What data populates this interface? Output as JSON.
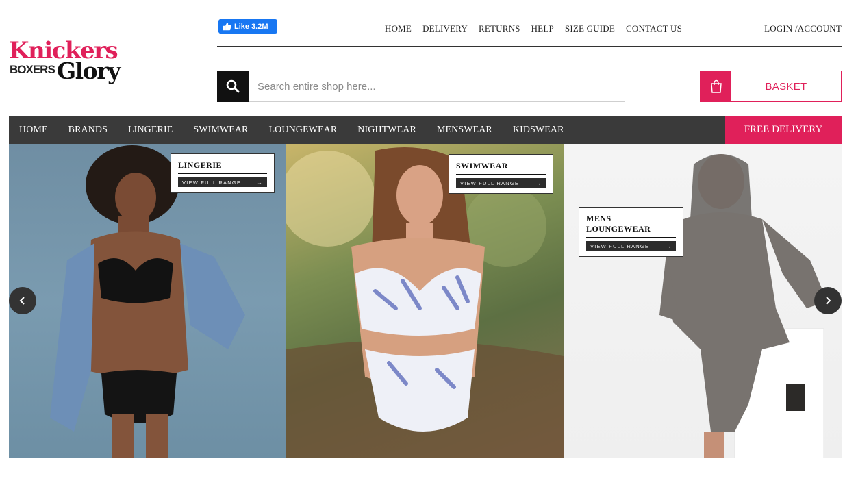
{
  "brand": {
    "line1": "Knickers",
    "line2": "BOXERS",
    "line3": "Glory"
  },
  "social": {
    "like_label": "Like 3.2M"
  },
  "top_nav": {
    "items": [
      "HOME",
      "DELIVERY",
      "RETURNS",
      "HELP",
      "SIZE GUIDE",
      "CONTACT US"
    ],
    "account": "LOGIN /ACCOUNT"
  },
  "search": {
    "placeholder": "Search entire shop here..."
  },
  "basket": {
    "label": "BASKET"
  },
  "main_nav": {
    "items": [
      "HOME",
      "BRANDS",
      "LINGERIE",
      "SWIMWEAR",
      "LOUNGEWEAR",
      "NIGHTWEAR",
      "MENSWEAR",
      "KIDSWEAR"
    ],
    "promo": "FREE DELIVERY"
  },
  "hero": {
    "panels": [
      {
        "title": "LINGERIE",
        "cta": "VIEW FULL RANGE"
      },
      {
        "title": "SWIMWEAR",
        "cta": "VIEW FULL RANGE"
      },
      {
        "title": "MENS LOUNGEWEAR",
        "cta": "VIEW FULL RANGE"
      }
    ]
  },
  "colors": {
    "accent": "#e0205a",
    "nav_bg": "#3a3a3a",
    "facebook": "#1877f2"
  }
}
